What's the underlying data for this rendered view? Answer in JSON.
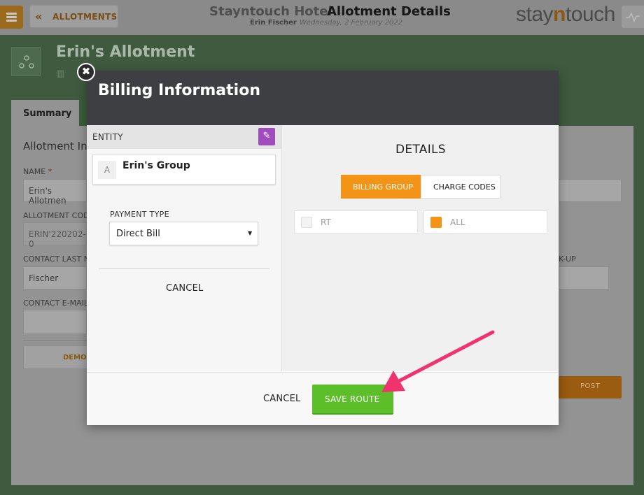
{
  "header": {
    "back_label": "ALLOTMENTS",
    "hotel_name": "Stayntouch Hotel",
    "page_title": "Allotment Details",
    "user_name": "Erin Fischer",
    "date": "Wednesday, 2 February 2022",
    "logo_pre": "stay",
    "logo_n": "n",
    "logo_post": "touch"
  },
  "page": {
    "allotment_title": "Erin's Allotment",
    "tab_summary": "Summary",
    "section_title": "Allotment Inf",
    "name_label": "NAME",
    "name_required": "*",
    "name_value": "Erin's Allotmen",
    "code_label": "ALLOTMENT CODE",
    "code_value": "ERIN'220202-0",
    "contact_last_label": "CONTACT LAST NA",
    "contact_last_value": "Fischer",
    "contact_email_label": "CONTACT E-MAIL",
    "pickup_label": "K-UP",
    "demo_label": "DEMO",
    "post_label": "POST"
  },
  "modal": {
    "title": "Billing Information",
    "close_glyph": "✖",
    "entity_label": "ENTITY",
    "edit_glyph": "✎",
    "entity_badge": "A",
    "entity_name": "Erin's Group",
    "payment_type_label": "PAYMENT TYPE",
    "payment_type_value": "Direct Bill",
    "caret_glyph": "▼",
    "left_cancel_label": "CANCEL",
    "details_title": "DETAILS",
    "tab_billing_group": "BILLING GROUP",
    "tab_charge_codes": "CHARGE CODES",
    "options": [
      {
        "label": "RT",
        "checked": false
      },
      {
        "label": "ALL",
        "checked": true
      }
    ],
    "footer_cancel_label": "CANCEL",
    "save_label": "SAVE ROUTE"
  },
  "colors": {
    "accent_orange": "#f39416",
    "save_green": "#5cbf2a",
    "edit_purple": "#a14cbd",
    "annotation_arrow": "#f0336f"
  }
}
